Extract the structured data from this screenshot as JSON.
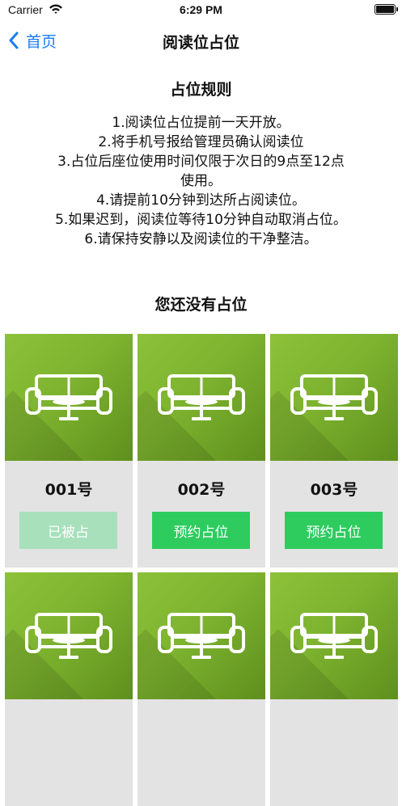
{
  "status_bar": {
    "carrier": "Carrier",
    "time": "6:29 PM"
  },
  "nav": {
    "back_label": "首页",
    "title": "阅读位占位"
  },
  "rules": {
    "title": "占位规则",
    "items": [
      "1.阅读位占位提前一天开放。",
      "2.将手机号报给管理员确认阅读位",
      "3.占位后座位使用时间仅限于次日的9点至12点",
      "使用。",
      "4.请提前10分钟到达所占阅读位。",
      "5.如果迟到，阅读位等待10分钟自动取消占位。",
      "6.请保持安静以及阅读位的干净整洁。"
    ]
  },
  "status_message": "您还没有占位",
  "seats": [
    {
      "number": "001号",
      "button": "已被占",
      "state": "taken"
    },
    {
      "number": "002号",
      "button": "预约占位",
      "state": "free"
    },
    {
      "number": "003号",
      "button": "预约占位",
      "state": "free"
    },
    {
      "number": "",
      "button": "",
      "state": "free"
    },
    {
      "number": "",
      "button": "",
      "state": "free"
    },
    {
      "number": "",
      "button": "",
      "state": "free"
    }
  ],
  "colors": {
    "accent_blue": "#1a7cf5",
    "button_green": "#2ecb5f",
    "button_disabled": "#a7e0bb",
    "tile_green": "#7db32f",
    "card_bg": "#e3e3e3"
  },
  "icons": [
    "wifi-icon",
    "battery-icon",
    "chevron-left-icon",
    "sofa-icon"
  ]
}
